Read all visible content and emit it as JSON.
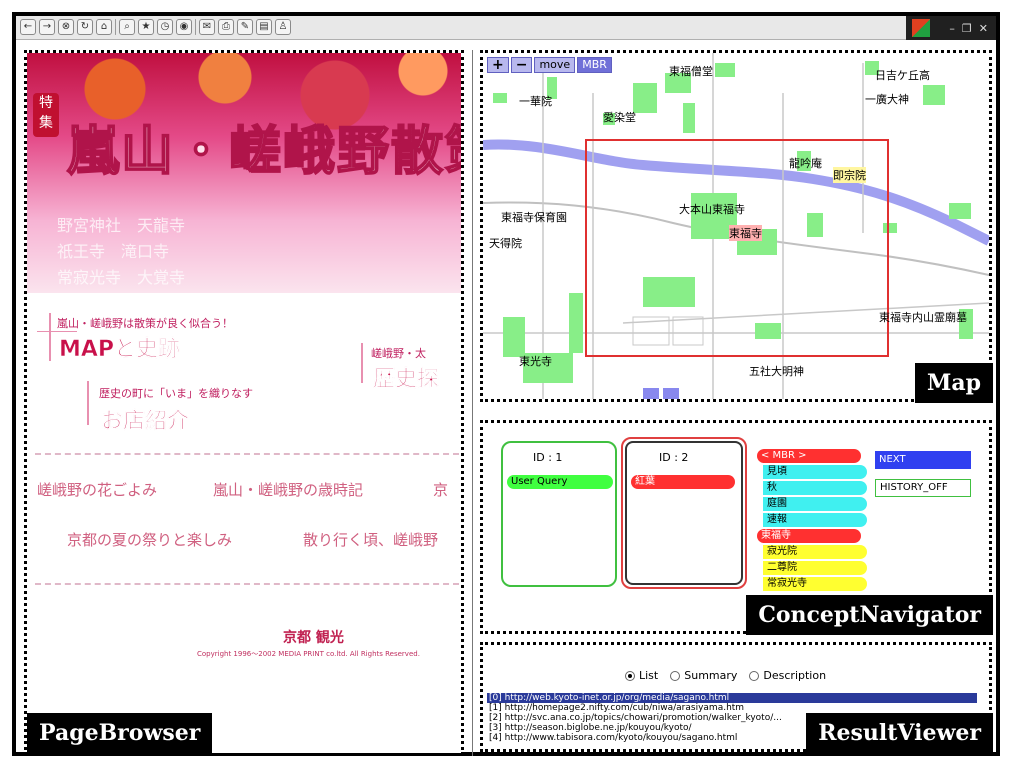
{
  "toolbar": {
    "icons": [
      "back-icon",
      "forward-icon",
      "stop-icon",
      "refresh-icon",
      "home-icon",
      "search-icon",
      "favorites-icon",
      "history-icon",
      "media-icon",
      "mail-icon",
      "print-icon",
      "edit-icon",
      "discuss-icon",
      "messenger-icon"
    ]
  },
  "page_browser": {
    "label": "PageBrowser",
    "badge": "特集",
    "title": "嵐山・嵯峨野散策",
    "sub_names": "野宮神社　天龍寺\n祇王寺　滝口寺\n常寂光寺　大覚寺",
    "links": {
      "map_caption": "嵐山・嵯峨野は散策が良く似合う！",
      "map_title": "MAPと史跡",
      "history_caption": "嵯峨野・太",
      "history_title": "歴史探",
      "shop_caption": "歴史の町に「いま」を織りなす",
      "shop_title": "お店紹介"
    },
    "seasons": {
      "row1_a": "嵯峨野の花ごよみ",
      "row1_b": "嵐山・嵯峨野の歳時記",
      "row1_c": "京",
      "row2_a": "京都の夏の祭りと楽しみ",
      "row2_b": "散り行く頃、嵯峨野"
    },
    "logo": "京都 観光",
    "copyright": "Copyright 1996～2002 MEDIA PRINT co.ltd. All Rights Reserved."
  },
  "map": {
    "label": "Map",
    "controls": {
      "plus": "+",
      "minus": "−",
      "move": "move",
      "mbr": "MBR"
    },
    "places": {
      "p1": "東福僧堂",
      "p2": "日吉ケ丘高",
      "p3": "一華院",
      "p4": "一廣大神",
      "p5": "愛染堂",
      "p6": "龍吟庵",
      "p7": "即宗院",
      "p8": "東福寺保育園",
      "p9": "大本山東福寺",
      "p10": "天得院",
      "p11": "東福寺",
      "p12": "東福寺内山霊廟墓",
      "p13": "東光寺",
      "p14": "五社大明神"
    }
  },
  "concept_navigator": {
    "label": "ConceptNavigator",
    "box1": {
      "id": "ID : 1",
      "item": "User Query"
    },
    "box2": {
      "id": "ID : 2",
      "item": "紅葉"
    },
    "concepts": {
      "c0": "< MBR >",
      "c1": "見頃",
      "c2": "秋",
      "c3": "庭園",
      "c4": "速報",
      "c5": "東福寺",
      "c6": "寂光院",
      "c7": "二尊院",
      "c8": "常寂光寺"
    },
    "next": "NEXT",
    "history": "HISTORY_OFF"
  },
  "result_viewer": {
    "label": "ResultViewer",
    "options": {
      "list": "List",
      "summary": "Summary",
      "description": "Description"
    },
    "results": [
      "[0]  http://web.kyoto-inet.or.jp/org/media/sagano.html",
      "[1]  http://homepage2.nifty.com/cub/niwa/arasiyama.htm",
      "[2]  http://svc.ana.co.jp/topics/chowari/promotion/walker_kyoto/...",
      "[3]  http://season.biglobe.ne.jp/kouyou/kyoto/",
      "[4]  http://www.tabisora.com/kyoto/kouyou/sagano.html"
    ]
  }
}
